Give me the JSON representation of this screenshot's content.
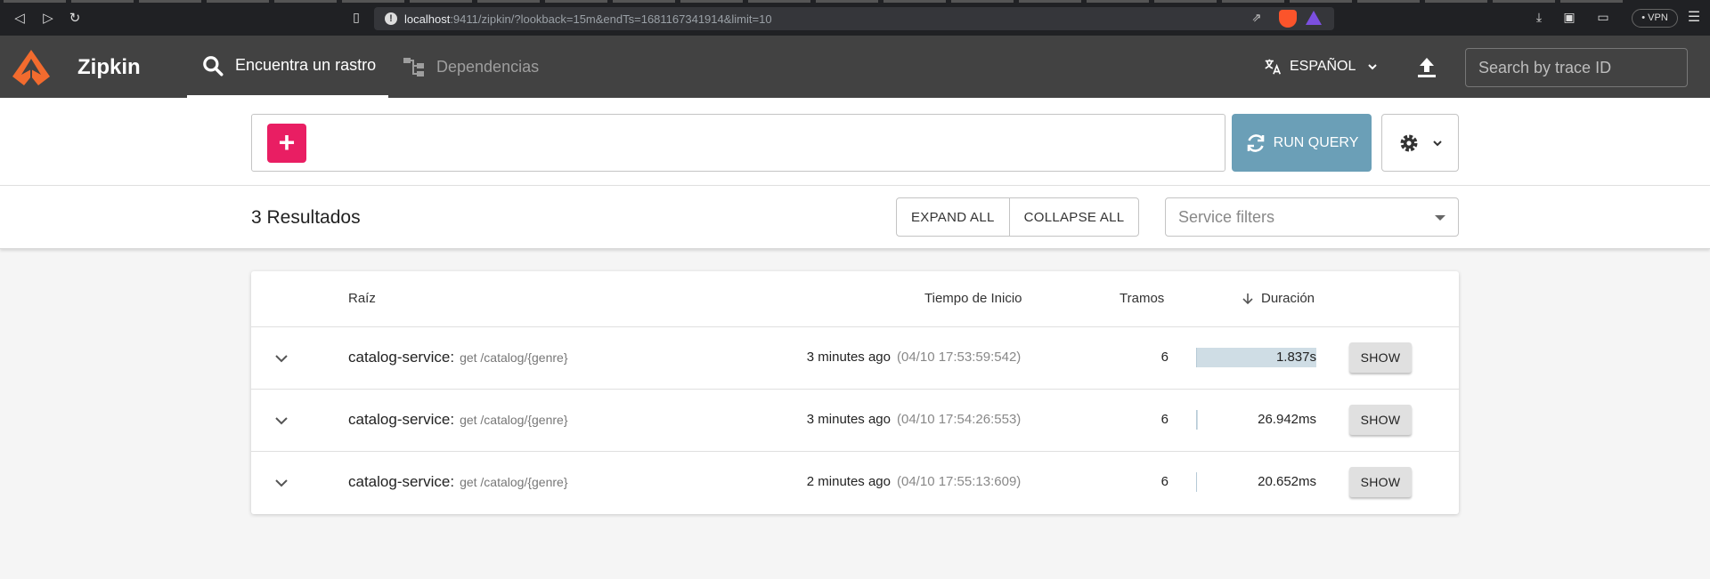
{
  "browser": {
    "url_host": "localhost",
    "url_rest": ":9411/zipkin/?lookback=15m&endTs=1681167341914&limit=10",
    "vpn_label": "VPN"
  },
  "header": {
    "brand": "Zipkin",
    "tabs": [
      {
        "label": "Encuentra un rastro",
        "active": true
      },
      {
        "label": "Dependencias",
        "active": false
      }
    ],
    "language": "ESPAÑOL",
    "trace_search_placeholder": "Search by trace ID"
  },
  "query": {
    "run_label": "RUN QUERY"
  },
  "results": {
    "count_label": "3 Resultados",
    "expand_all": "EXPAND ALL",
    "collapse_all": "COLLAPSE ALL",
    "service_filter_placeholder": "Service filters"
  },
  "table": {
    "headers": {
      "root": "Raíz",
      "start": "Tiempo de Inicio",
      "spans": "Tramos",
      "duration": "Duración"
    },
    "rows": [
      {
        "service": "catalog-service:",
        "span": "get /catalog/{genre}",
        "start_relative": "3 minutes ago",
        "start_absolute": "(04/10 17:53:59:542)",
        "spans": "6",
        "duration": "1.837s",
        "duration_fraction": 1.0,
        "action": "SHOW"
      },
      {
        "service": "catalog-service:",
        "span": "get /catalog/{genre}",
        "start_relative": "3 minutes ago",
        "start_absolute": "(04/10 17:54:26:553)",
        "spans": "6",
        "duration": "26.942ms",
        "duration_fraction": 0.015,
        "action": "SHOW"
      },
      {
        "service": "catalog-service:",
        "span": "get /catalog/{genre}",
        "start_relative": "2 minutes ago",
        "start_absolute": "(04/10 17:55:13:609)",
        "spans": "6",
        "duration": "20.652ms",
        "duration_fraction": 0.011,
        "action": "SHOW"
      }
    ]
  },
  "colors": {
    "header_bg": "#424242",
    "add_button": "#e91e63",
    "run_button": "#6b9fb7",
    "logo": "#f26b2e",
    "duration_bar": "#cfdde5"
  }
}
